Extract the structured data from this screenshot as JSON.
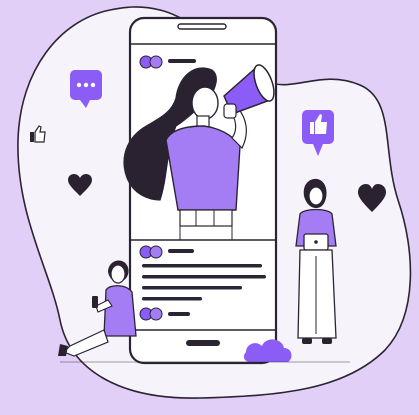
{
  "colors": {
    "background": "#e2cff7",
    "blob": "#f7f3fb",
    "outline": "#2b2433",
    "accent": "#8b5cf6",
    "accent_light": "#a47df5",
    "hair": "#2a2230",
    "white": "#ffffff"
  },
  "icons": {
    "chat_bubble": "chat-bubble-dots-icon",
    "like_bubble": "thumbs-up-bubble-icon",
    "like_small": "thumbs-up-icon",
    "heart": "heart-icon",
    "cloud": "cloud-icon",
    "megaphone": "megaphone-icon"
  }
}
